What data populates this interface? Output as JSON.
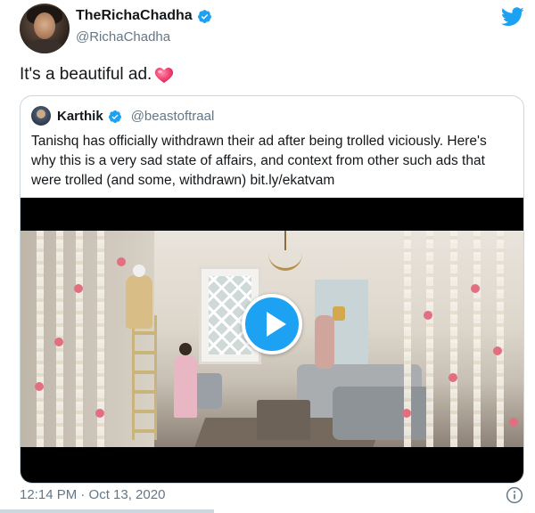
{
  "author": {
    "display_name": "TheRichaChadha",
    "handle": "@RichaChadha",
    "verified": true
  },
  "tweet": {
    "text": "It's a beautiful ad."
  },
  "quoted_tweet": {
    "display_name": "Karthik",
    "handle": "@beastoftraal",
    "verified": true,
    "text": "Tanishq has officially withdrawn their ad after being trolled viciously. Here's why this is a very sad state of affairs, and context from other such ads that were trolled (and some, withdrawn) bit.ly/ekatvam"
  },
  "timestamp": "12:14 PM · Oct 13, 2020",
  "colors": {
    "accent": "#1da1f2",
    "text": "#14171a",
    "secondary": "#657786",
    "border": "#ccd6dd",
    "heart": "#e0245e"
  },
  "icons": {
    "brand": "twitter-bird-icon",
    "verified": "verified-badge-icon",
    "emoji": "heart-emoji-icon",
    "play": "play-icon",
    "info": "info-icon"
  }
}
